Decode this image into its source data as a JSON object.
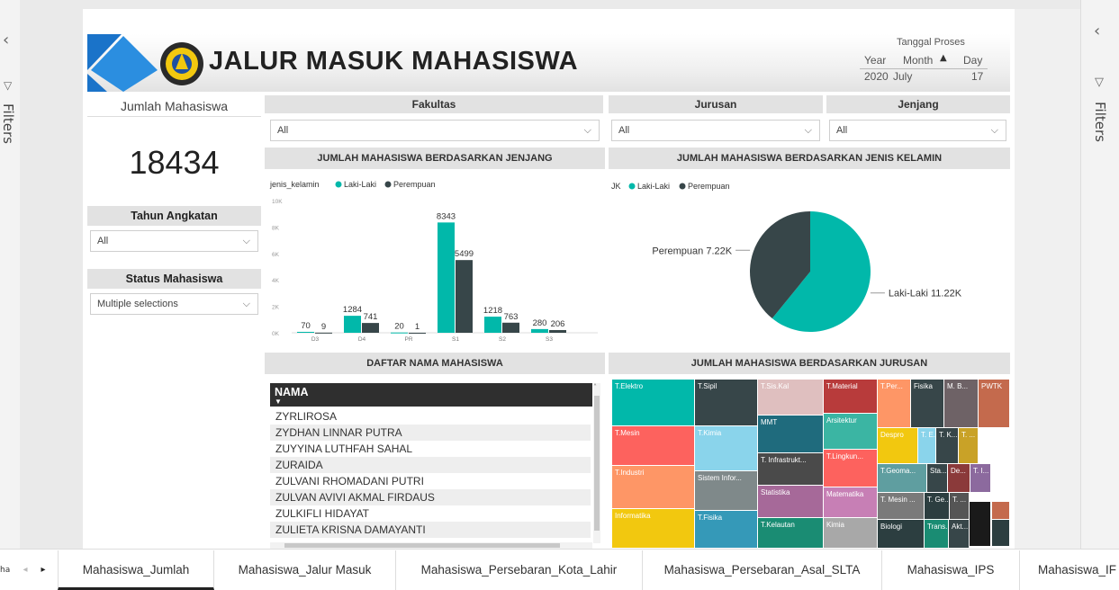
{
  "header": {
    "title": "JALUR MASUK MAHASISWA",
    "date": {
      "caption": "Tanggal Proses",
      "year_label": "Year",
      "month_label": "Month",
      "day_label": "Day",
      "year": "2020",
      "month": "July",
      "day": "17"
    }
  },
  "filters_pane_label": "Filters",
  "left": {
    "count_label": "Jumlah Mahasiswa",
    "count_value": "18434",
    "tahun_title": "Tahun Angkatan",
    "tahun_value": "All",
    "status_title": "Status Mahasiswa",
    "status_value": "Multiple selections"
  },
  "slicers": {
    "fakultas_title": "Fakultas",
    "fakultas_value": "All",
    "jurusan_title": "Jurusan",
    "jurusan_value": "All",
    "jenjang_title": "Jenjang",
    "jenjang_value": "All"
  },
  "bar_title": "JUMLAH MAHASISWA BERDASARKAN JENJANG",
  "pie_title": "JUMLAH MAHASISWA BERDASARKAN JENIS KELAMIN",
  "list_title": "DAFTAR NAMA MAHASISWA",
  "tree_title": "JUMLAH MAHASISWA BERDASARKAN JURUSAN",
  "colors": {
    "laki": "#01b8aa",
    "perempuan": "#374649",
    "accent": "#118dff"
  },
  "chart_data": [
    {
      "type": "bar",
      "legend_title": "jenis_kelamin",
      "categories": [
        "D3",
        "D4",
        "PR",
        "S1",
        "S2",
        "S3"
      ],
      "series": [
        {
          "name": "Laki-Laki",
          "values": [
            70,
            1284,
            20,
            8343,
            1218,
            280
          ]
        },
        {
          "name": "Perempuan",
          "values": [
            9,
            741,
            1,
            5499,
            763,
            206
          ]
        }
      ],
      "y_ticks": [
        "0K",
        "2K",
        "4K",
        "6K",
        "8K",
        "10K"
      ],
      "ylim": [
        0,
        10000
      ],
      "legend_position": "top-left"
    },
    {
      "type": "pie",
      "legend_title": "JK",
      "slices": [
        {
          "name": "Laki-Laki",
          "value": 11.22,
          "label": "Laki-Laki 11.22K"
        },
        {
          "name": "Perempuan",
          "value": 7.22,
          "label": "Perempuan 7.22K"
        }
      ],
      "legend_position": "top-left"
    }
  ],
  "list": {
    "header": "NAMA",
    "rows": [
      "ZYRLIROSA",
      "ZYDHAN LINNAR PUTRA",
      "ZUYYINA LUTHFAH SAHAL",
      "ZURAIDA",
      "ZULVANI RHOMADANI PUTRI",
      "ZULVAN AVIVI AKMAL FIRDAUS",
      "ZULKIFLI HIDAYAT",
      "ZULIETA KRISNA DAMAYANTI"
    ]
  },
  "treemap": [
    {
      "label": "T.Elektro",
      "color": "#01b8aa"
    },
    {
      "label": "T.Mesin",
      "color": "#fd625e"
    },
    {
      "label": "T.Industri",
      "color": "#fe9666"
    },
    {
      "label": "Informatika",
      "color": "#f2c80f"
    },
    {
      "label": "T.Sipil",
      "color": "#374649"
    },
    {
      "label": "T.Kimia",
      "color": "#8ad4eb"
    },
    {
      "label": "Sistem Infor...",
      "color": "#7f898a"
    },
    {
      "label": "T.Fisika",
      "color": "#3599b8"
    },
    {
      "label": "T.Sis.Kal",
      "color": "#dfbfbf"
    },
    {
      "label": "MMT",
      "color": "#1f6b7d"
    },
    {
      "label": "T. Infrastrukt...",
      "color": "#4a4a4a"
    },
    {
      "label": "Statistika",
      "color": "#a66999"
    },
    {
      "label": "T.Kelautan",
      "color": "#1a8c73"
    },
    {
      "label": "T.Material",
      "color": "#b83b3b"
    },
    {
      "label": "Arsitektur",
      "color": "#3bb5a3"
    },
    {
      "label": "T.Lingkun...",
      "color": "#fd625e"
    },
    {
      "label": "Matematika",
      "color": "#c77fb5"
    },
    {
      "label": "Kimia",
      "color": "#a8a8a8"
    },
    {
      "label": "T.Per...",
      "color": "#fe9666"
    },
    {
      "label": "Fisika",
      "color": "#374649"
    },
    {
      "label": "M. B...",
      "color": "#6e6266"
    },
    {
      "label": "PWTK",
      "color": "#c46a4d"
    },
    {
      "label": "Despro",
      "color": "#f2c80f"
    },
    {
      "label": "T. E...",
      "color": "#8ad4eb"
    },
    {
      "label": "T. K...",
      "color": "#374649"
    },
    {
      "label": "T. ...",
      "color": "#c9a227"
    },
    {
      "label": "T.Geoma...",
      "color": "#5f9ea0"
    },
    {
      "label": "Sta...",
      "color": "#374649"
    },
    {
      "label": "De...",
      "color": "#8b3a3a"
    },
    {
      "label": "T. I...",
      "color": "#8c6a9e"
    },
    {
      "label": "T. Mesin ...",
      "color": "#7a7a7a"
    },
    {
      "label": "T. Ge...",
      "color": "#2c3e40"
    },
    {
      "label": "T. ...",
      "color": "#555"
    },
    {
      "label": "Biologi",
      "color": "#2c3e40"
    },
    {
      "label": "Trans...",
      "color": "#1a8c73"
    },
    {
      "label": "Akt...",
      "color": "#374649"
    }
  ],
  "tabs": [
    "Mahasiswa_Jumlah",
    "Mahasiswa_Jalur Masuk",
    "Mahasiswa_Persebaran_Kota_Lahir",
    "Mahasiswa_Persebaran_Asal_SLTA",
    "Mahasiswa_IPS",
    "Mahasiswa_IF"
  ],
  "tab_prefix": "ha"
}
